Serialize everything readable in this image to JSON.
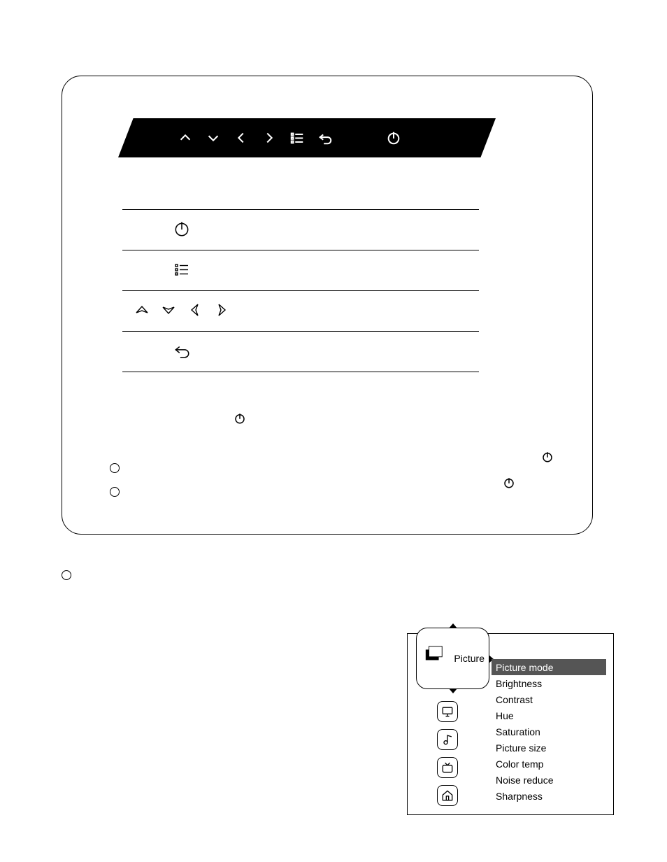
{
  "panel": {
    "controlbar_icons": [
      "up",
      "down",
      "left",
      "right",
      "menu",
      "back",
      "power"
    ],
    "rows": [
      {
        "icons": [
          "power"
        ]
      },
      {
        "icons": [
          "menu"
        ]
      },
      {
        "icons": [
          "up",
          "down",
          "left",
          "right"
        ]
      },
      {
        "icons": [
          "back"
        ]
      }
    ],
    "bullets": [
      "",
      ""
    ]
  },
  "osd": {
    "tab_label": "Picture",
    "side_icons": [
      "pc",
      "music",
      "tv",
      "home"
    ],
    "items": [
      "Picture mode",
      "Brightness",
      "Contrast",
      "Hue",
      "Saturation",
      "Picture size",
      "Color temp",
      "Noise reduce",
      "Sharpness"
    ],
    "selected_index": 0
  }
}
